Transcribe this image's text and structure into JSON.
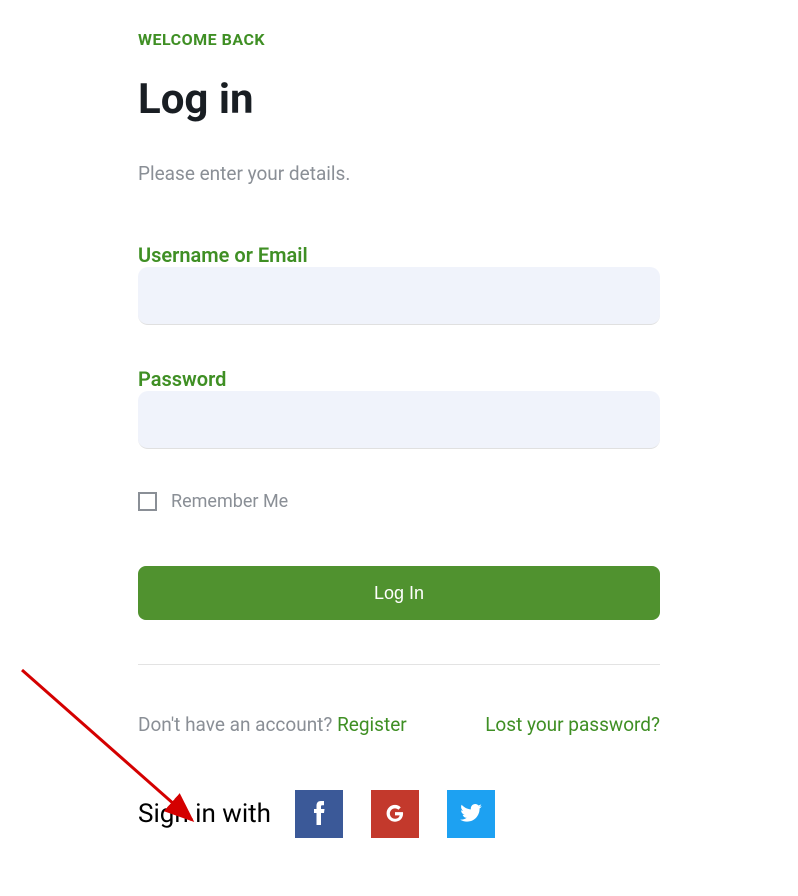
{
  "welcome": "WELCOME BACK",
  "title": "Log in",
  "subtitle": "Please enter your details.",
  "fields": {
    "username_label": "Username or Email",
    "password_label": "Password"
  },
  "remember_label": "Remember Me",
  "login_button": "Log In",
  "links": {
    "no_account": "Don't have an account? ",
    "register": "Register",
    "lost_password": "Lost your password?"
  },
  "signin_with": "Sign in with",
  "colors": {
    "accent": "#3f8f24",
    "button": "#50922f",
    "input_bg": "#f0f3fb",
    "muted": "#8a8f96"
  }
}
